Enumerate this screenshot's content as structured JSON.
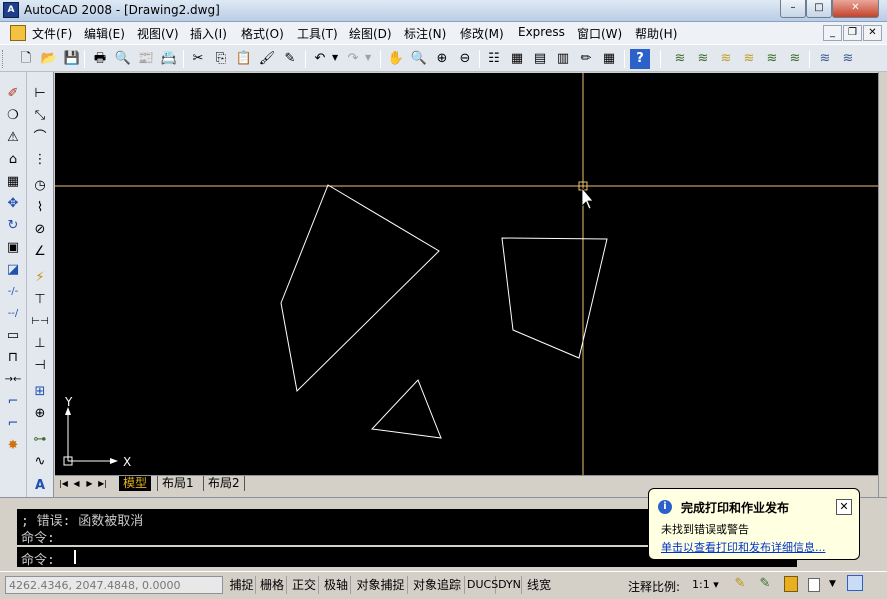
{
  "window": {
    "title": "AutoCAD 2008 - [Drawing2.dwg]",
    "app_icon_text": "A",
    "minimize": "–",
    "maximize": "□",
    "close": "✕"
  },
  "menu": {
    "items": [
      "文件(F)",
      "编辑(E)",
      "视图(V)",
      "插入(I)",
      "格式(O)",
      "工具(T)",
      "绘图(D)",
      "标注(N)",
      "修改(M)",
      "Express",
      "窗口(W)",
      "帮助(H)"
    ],
    "mdi_minimize": "_",
    "mdi_restore": "❐",
    "mdi_close": "✕"
  },
  "toolbar": {
    "icons": [
      "new-icon",
      "open-icon",
      "save-icon",
      "print-icon",
      "print-preview-icon",
      "publish-icon",
      "plot-icon",
      "cut-icon",
      "copy-icon",
      "paste-icon",
      "match-properties-icon",
      "block-editor-icon",
      "undo-icon",
      "redo-icon",
      "pan-icon",
      "zoom-realtime-icon",
      "zoom-window-icon",
      "zoom-previous-icon",
      "properties-icon",
      "design-center-icon",
      "tool-palettes-icon",
      "sheet-set-icon",
      "markup-icon",
      "calculator-icon",
      "help-icon",
      "layer-icon-1",
      "layer-icon-2",
      "layer-icon-3",
      "layer-icon-4",
      "layer-icon-5",
      "layer-icon-6",
      "layer-icon-7",
      "layer-icon-8"
    ],
    "glyphs": [
      "🗋",
      "📂",
      "💾",
      "🖶",
      "🔍",
      "📰",
      "📇",
      "✂",
      "⎘",
      "📋",
      "🖌",
      "✎",
      "↶",
      "↷",
      "✋",
      "🔍",
      "⊕",
      "⊖",
      "☷",
      "▦",
      "▤",
      "▥",
      "✏",
      "▦",
      "?",
      "≋",
      "≋",
      "≋",
      "≋",
      "≋",
      "≋",
      "≋",
      "≋"
    ]
  },
  "left_toolbar_1": {
    "icons": [
      "erase-icon",
      "copy-object-icon",
      "mirror-icon",
      "offset-icon",
      "array-icon",
      "move-icon",
      "rotate-icon",
      "scale-icon",
      "stretch-icon",
      "trim-icon",
      "extend-icon",
      "break-at-point-icon",
      "break-icon",
      "join-icon",
      "chamfer-icon",
      "fillet-icon",
      "explode-icon"
    ],
    "glyphs": [
      "✐",
      "❍",
      "⚠",
      "⌂",
      "▦",
      "✥",
      "↻",
      "▣",
      "◪",
      "-/-",
      "--/",
      "▭",
      "⊓",
      "→←",
      "⌐",
      "⌐",
      "✸"
    ]
  },
  "left_toolbar_2": {
    "icons": [
      "linear-dim-icon",
      "aligned-dim-icon",
      "arc-length-icon",
      "ordinate-icon",
      "radius-icon",
      "jogged-icon",
      "diameter-icon",
      "angular-icon",
      "quick-dim-icon",
      "baseline-icon",
      "continue-icon",
      "space-icon",
      "break-dim-icon",
      "tolerance-icon",
      "center-mark-icon",
      "inspect-icon",
      "jogged-linear-icon",
      "text-icon"
    ],
    "glyphs": [
      "⊢",
      "⤡",
      "⌒",
      "⋮",
      "◷",
      "⌇",
      "⊘",
      "∠",
      "⚡",
      "⊤",
      "⊢⊣",
      "⊥",
      "⊣",
      "⊞",
      "⊕",
      "⊶",
      "∿",
      "A"
    ]
  },
  "drawing": {
    "ucs_x": "X",
    "ucs_y": "Y",
    "crosshair_color": "#f0c070",
    "entity_color": "#ffffff"
  },
  "layout_tabs": {
    "nav": [
      "|◀",
      "◀",
      "▶",
      "▶|"
    ],
    "tabs": [
      "模型",
      "布局1",
      "布局2"
    ],
    "active": "模型"
  },
  "command": {
    "history": [
      "; 错误: 函数被取消",
      "命令:"
    ],
    "prompt": "命令:"
  },
  "notification": {
    "title": "完成打印和作业发布",
    "message": "未找到错误或警告",
    "link": "单击以查看打印和发布详细信息..."
  },
  "statusbar": {
    "coords": "4262.4346, 2047.4848, 0.0000",
    "toggles": [
      "捕捉",
      "栅格",
      "正交",
      "极轴",
      "对象捕捉",
      "对象追踪",
      "DUCS",
      "DYN",
      "线宽"
    ],
    "annotation_scale_label": "注释比例:",
    "annotation_scale_value": "1:1 ▾"
  }
}
